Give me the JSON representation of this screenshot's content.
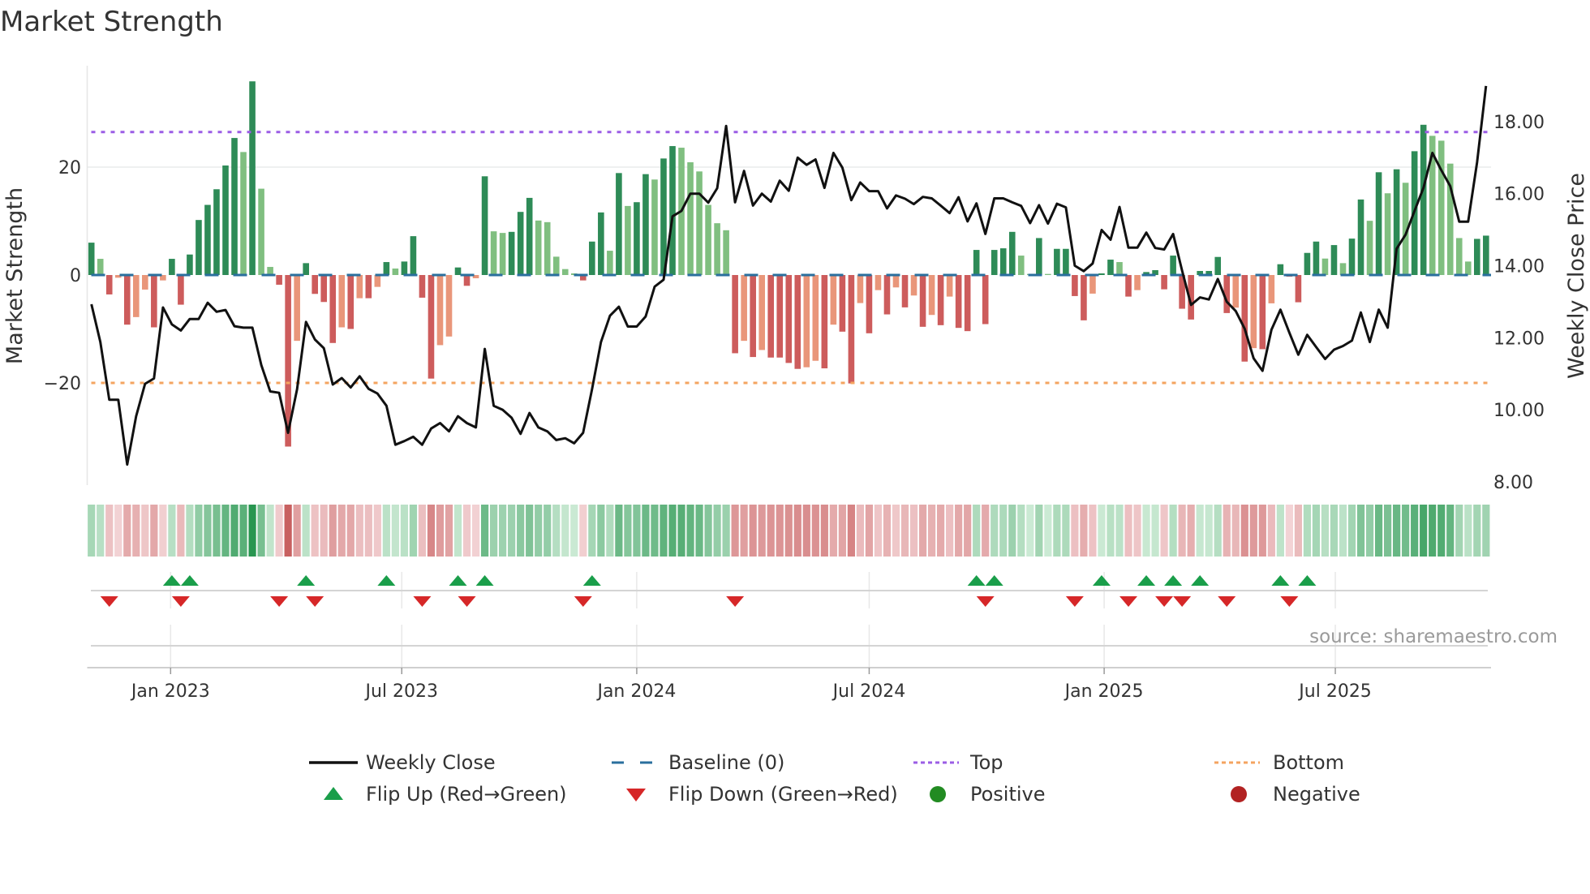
{
  "title": "Market Strength",
  "source": "source: sharemaestro.com",
  "chart_data": {
    "type": "bar",
    "title": "Market Strength",
    "x_start": "2022-10-31",
    "x_step_days": 7,
    "ylabel_left": "Market Strength",
    "ylabel_right": "Weekly Close Price",
    "ylim_left": [
      -40.2,
      40.1
    ],
    "ylim_right": [
      8.0,
      19.65
    ],
    "left_ticks": [
      {
        "v": 20,
        "label": "20"
      },
      {
        "v": 0,
        "label": "0"
      },
      {
        "v": -20,
        "label": "−20"
      }
    ],
    "right_ticks": [
      {
        "v": 18,
        "label": "18.00"
      },
      {
        "v": 16,
        "label": "16.00"
      },
      {
        "v": 14,
        "label": "14.00"
      },
      {
        "v": 12,
        "label": "12.00"
      },
      {
        "v": 10,
        "label": "10.00"
      },
      {
        "v": 8,
        "label": "8.00"
      }
    ],
    "x_ticks": [
      {
        "date": "2023-01-01",
        "label": "Jan 2023"
      },
      {
        "date": "2023-07-01",
        "label": "Jul 2023"
      },
      {
        "date": "2024-01-01",
        "label": "Jan 2024"
      },
      {
        "date": "2024-07-01",
        "label": "Jul 2024"
      },
      {
        "date": "2025-01-01",
        "label": "Jan 2025"
      },
      {
        "date": "2025-07-01",
        "label": "Jul 2025"
      }
    ],
    "top_level": 26.5,
    "bottom_level": -20,
    "baseline": 0,
    "grid": true,
    "legend_position": "bottom",
    "colors": {
      "pos_dark": "#2e8b57",
      "pos_light": "#80bf80",
      "neg_dark": "#cd5c5c",
      "neg_light": "#e9967a",
      "baseline": "#2a6f9e",
      "top": "#9b5de5",
      "bottom": "#f4a460",
      "line": "#111111",
      "flip_up": "#1a9e4a",
      "flip_down": "#d62728",
      "positive": "#228b22",
      "negative": "#b22222"
    },
    "strength": [
      6.0,
      3.0,
      -3.6,
      -0.5,
      -9.2,
      -7.8,
      -2.7,
      -9.7,
      -1.0,
      3.0,
      -5.5,
      3.8,
      10.2,
      13.0,
      15.9,
      20.3,
      25.4,
      22.8,
      35.9,
      16.0,
      1.5,
      -1.8,
      -31.8,
      -12.2,
      2.2,
      -3.5,
      -5.0,
      -12.6,
      -9.7,
      -10.0,
      -4.3,
      -4.3,
      -2.2,
      2.4,
      1.2,
      2.5,
      7.2,
      -4.2,
      -19.2,
      -13.0,
      -11.4,
      1.4,
      -2.0,
      -0.6,
      18.3,
      8.1,
      7.8,
      8.0,
      11.7,
      14.3,
      10.1,
      9.8,
      3.4,
      1.1,
      0.3,
      -1.0,
      6.2,
      11.6,
      4.5,
      18.9,
      12.8,
      13.5,
      18.7,
      17.7,
      21.6,
      23.9,
      23.6,
      20.9,
      19.2,
      13.0,
      9.6,
      8.3,
      -14.5,
      -12.2,
      -15.2,
      -13.9,
      -15.3,
      -15.3,
      -16.3,
      -17.4,
      -17.1,
      -15.9,
      -17.3,
      -9.2,
      -10.5,
      -20.1,
      -5.2,
      -10.8,
      -2.8,
      -7.3,
      -2.3,
      -6.0,
      -3.8,
      -9.6,
      -7.4,
      -9.3,
      -4.0,
      -9.8,
      -10.4,
      4.65,
      -9.1,
      4.65,
      4.95,
      8.0,
      3.6,
      0.2,
      6.85,
      0.2,
      4.85,
      4.85,
      -3.9,
      -8.4,
      -3.45,
      0.3,
      2.85,
      2.4,
      -4.0,
      -2.8,
      0.55,
      0.9,
      -2.65,
      3.6,
      -6.25,
      -8.25,
      0.75,
      0.75,
      3.35,
      -7.05,
      -6.05,
      -16.05,
      -13.55,
      -13.75,
      -5.25,
      2.0,
      -0.3,
      -5.05,
      4.1,
      6.2,
      3.05,
      5.55,
      2.2,
      6.75,
      14.0,
      10.05,
      19.05,
      15.15,
      19.6,
      17.1,
      22.95,
      27.85,
      25.8,
      24.9,
      20.65,
      6.85,
      2.5,
      6.7,
      7.3
    ],
    "weekly_close": [
      12.93,
      11.88,
      10.28,
      10.28,
      8.48,
      9.82,
      10.72,
      10.87,
      12.84,
      12.37,
      12.2,
      12.52,
      12.52,
      12.97,
      12.72,
      12.77,
      12.32,
      12.28,
      12.28,
      11.24,
      10.51,
      10.47,
      9.36,
      10.57,
      12.44,
      11.95,
      11.71,
      10.7,
      10.88,
      10.62,
      10.93,
      10.58,
      10.45,
      10.11,
      9.03,
      9.13,
      9.25,
      9.03,
      9.48,
      9.63,
      9.4,
      9.82,
      9.63,
      9.51,
      11.69,
      10.11,
      10.0,
      9.78,
      9.33,
      9.91,
      9.51,
      9.4,
      9.16,
      9.21,
      9.07,
      9.36,
      10.57,
      11.88,
      12.61,
      12.86,
      12.31,
      12.31,
      12.59,
      13.42,
      13.61,
      15.37,
      15.52,
      16.0,
      16.0,
      15.75,
      16.15,
      17.88,
      15.76,
      16.63,
      15.67,
      16.0,
      15.78,
      16.36,
      16.08,
      17.0,
      16.8,
      16.95,
      16.16,
      17.13,
      16.72,
      15.82,
      16.31,
      16.07,
      16.07,
      15.59,
      15.95,
      15.86,
      15.71,
      15.91,
      15.87,
      15.67,
      15.46,
      15.9,
      15.23,
      15.73,
      14.88,
      15.87,
      15.87,
      15.76,
      15.66,
      15.18,
      15.68,
      15.17,
      15.72,
      15.62,
      14.0,
      13.85,
      14.06,
      14.99,
      14.72,
      15.63,
      14.5,
      14.5,
      14.92,
      14.49,
      14.45,
      14.88,
      13.87,
      12.91,
      13.12,
      13.06,
      13.63,
      13.0,
      12.74,
      12.25,
      11.43,
      11.08,
      12.22,
      12.78,
      12.14,
      11.53,
      12.08,
      11.74,
      11.41,
      11.67,
      11.77,
      11.92,
      12.7,
      11.88,
      12.78,
      12.28,
      14.47,
      14.86,
      15.52,
      16.16,
      17.13,
      16.65,
      16.21,
      15.22,
      15.22,
      16.87,
      18.99
    ],
    "legend": [
      {
        "key": "weekly_close",
        "label": "Weekly Close"
      },
      {
        "key": "baseline",
        "label": "Baseline (0)"
      },
      {
        "key": "top",
        "label": "Top"
      },
      {
        "key": "bottom",
        "label": "Bottom"
      },
      {
        "key": "flip_up",
        "label": "Flip Up (Red→Green)"
      },
      {
        "key": "flip_down",
        "label": "Flip Down (Green→Red)"
      },
      {
        "key": "positive",
        "label": "Positive"
      },
      {
        "key": "negative",
        "label": "Negative"
      }
    ]
  }
}
